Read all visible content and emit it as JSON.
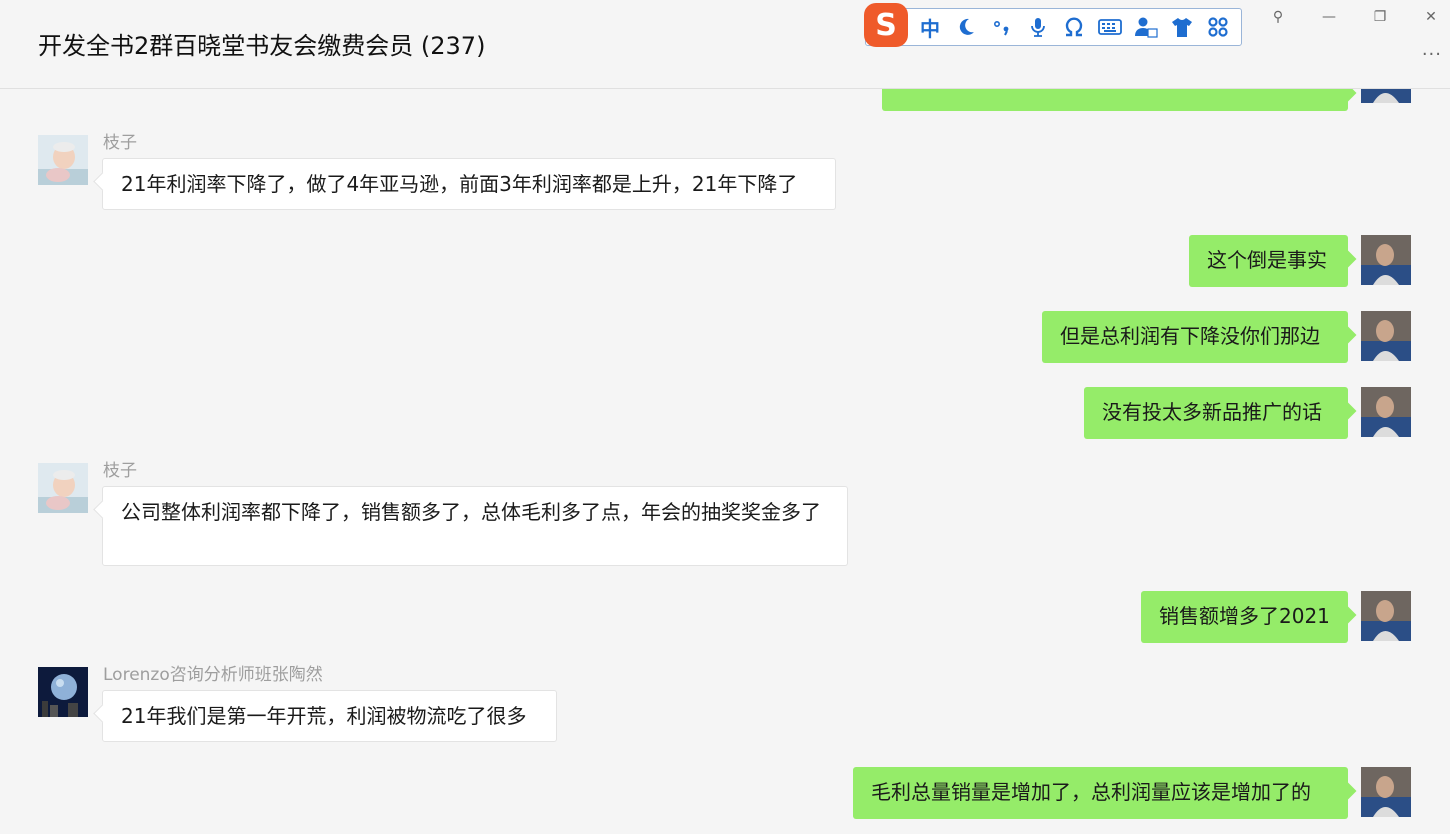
{
  "window": {
    "title": "开发全书2群百晓堂书友会缴费会员 (237)",
    "controls": {
      "pin": "⚲",
      "minimize": "—",
      "restore": "❐",
      "close": "✕"
    },
    "more": "···"
  },
  "ime_toolbar": {
    "logo": "S",
    "mode": "中",
    "buttons": [
      "moon-icon",
      "punctuation-icon",
      "microphone-icon",
      "omega-icon",
      "keyboard-icon",
      "user-icon",
      "shirt-icon",
      "apps-icon"
    ]
  },
  "messages": [
    {
      "sender": "枝子",
      "text": "21年利润率下降了，做了4年亚马逊，前面3年利润率都是上升，21年下降了"
    },
    {
      "sender": "",
      "text": "这个倒是事实"
    },
    {
      "sender": "",
      "text": "但是总利润有下降没你们那边"
    },
    {
      "sender": "",
      "text": "没有投太多新品推广的话"
    },
    {
      "sender": "枝子",
      "text": "公司整体利润率都下降了，销售额多了，总体毛利多了点，年会的抽奖奖金多了"
    },
    {
      "sender": "",
      "text": "销售额增多了2021"
    },
    {
      "sender": "Lorenzo咨询分析师班张陶然",
      "text": "21年我们是第一年开荒，利润被物流吃了很多"
    },
    {
      "sender": "",
      "text": "毛利总量销量是增加了，总利润量应该是增加了的"
    }
  ],
  "colors": {
    "outgoing_bubble": "#95ec69",
    "incoming_bubble": "#ffffff",
    "background": "#f5f5f5",
    "ime_accent": "#1e6dd0",
    "ime_logo": "#ef5a2a"
  }
}
